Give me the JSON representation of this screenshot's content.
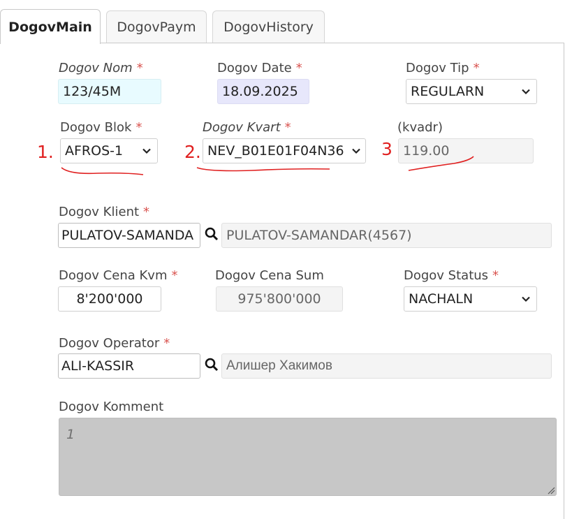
{
  "tabs": [
    {
      "label": "DogovMain",
      "active": true
    },
    {
      "label": "DogovPaym",
      "active": false
    },
    {
      "label": "DogovHistory",
      "active": false
    }
  ],
  "form": {
    "nom": {
      "label": "Dogov Nom",
      "value": "123/45M",
      "bg": "#e8fbff"
    },
    "date": {
      "label": "Dogov Date",
      "value": "18.09.2025",
      "bg": "#e7e7fb"
    },
    "tip": {
      "label": "Dogov Tip",
      "value": "REGULARN"
    },
    "blok": {
      "label": "Dogov Blok",
      "value": "AFROS-1"
    },
    "kvart": {
      "label": "Dogov Kvart",
      "value": "NEV_B01E01F04N36"
    },
    "kvadr": {
      "label": "(kvadr)",
      "value": "119.00"
    },
    "klient": {
      "label": "Dogov Klient",
      "value": "PULATOV-SAMANDA",
      "display": "PULATOV-SAMANDAR(4567)"
    },
    "cena_kvm": {
      "label": "Dogov Cena Kvm",
      "value": "8'200'000"
    },
    "cena_sum": {
      "label": "Dogov Cena Sum",
      "value": "975'800'000"
    },
    "status": {
      "label": "Dogov Status",
      "value": "NACHALN"
    },
    "operator": {
      "label": "Dogov Operator",
      "value": "ALI-KASSIR",
      "display": "Алишер Хакимов"
    },
    "komment": {
      "label": "Dogov Komment",
      "value": "1"
    },
    "required_mark": "*"
  },
  "annotations": {
    "markers": [
      "1.",
      "2.",
      "3"
    ],
    "color": "#e02020"
  },
  "icons": {
    "search": "search-icon",
    "dropdown": "chevron-down-icon",
    "resize": "resize-handle-icon"
  },
  "colors": {
    "required": "#d9534f",
    "tab_border": "#c9c9c9",
    "readonly_bg": "#f4f4f4",
    "comment_bg": "#c7c7c7"
  }
}
